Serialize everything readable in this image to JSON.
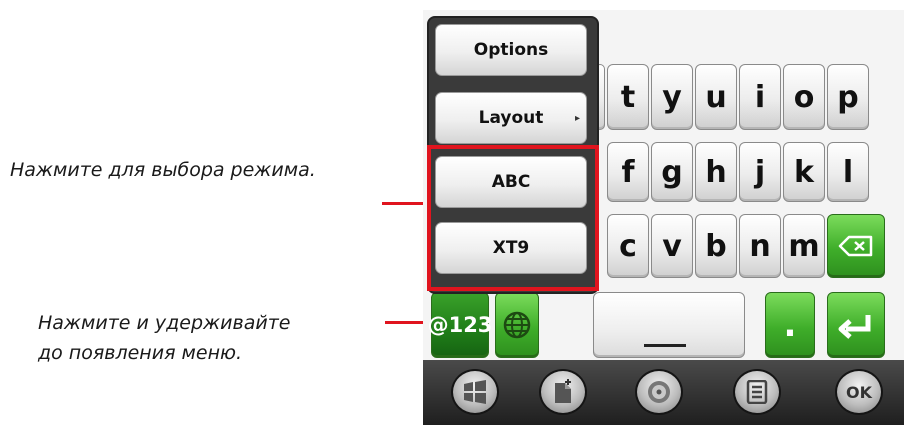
{
  "annotations": {
    "mode_select": "Нажмите для выбора режима.",
    "hold_lines": [
      "Нажмите и удерживайте",
      "до появления меню."
    ]
  },
  "popup_menu": {
    "options": "Options",
    "layout": "Layout",
    "abc": "ABC",
    "xt9": "XT9"
  },
  "keyboard": {
    "row1": [
      "t",
      "y",
      "u",
      "i",
      "o",
      "p"
    ],
    "row2": [
      "f",
      "g",
      "h",
      "j",
      "k",
      "l"
    ],
    "row3": [
      "c",
      "v",
      "b",
      "n",
      "m"
    ],
    "mode_key": "@123",
    "period_key": "."
  },
  "taskbar": {
    "ok": "OK"
  },
  "colors": {
    "highlight": "#e0141e",
    "key_green": "#3fae2a"
  }
}
